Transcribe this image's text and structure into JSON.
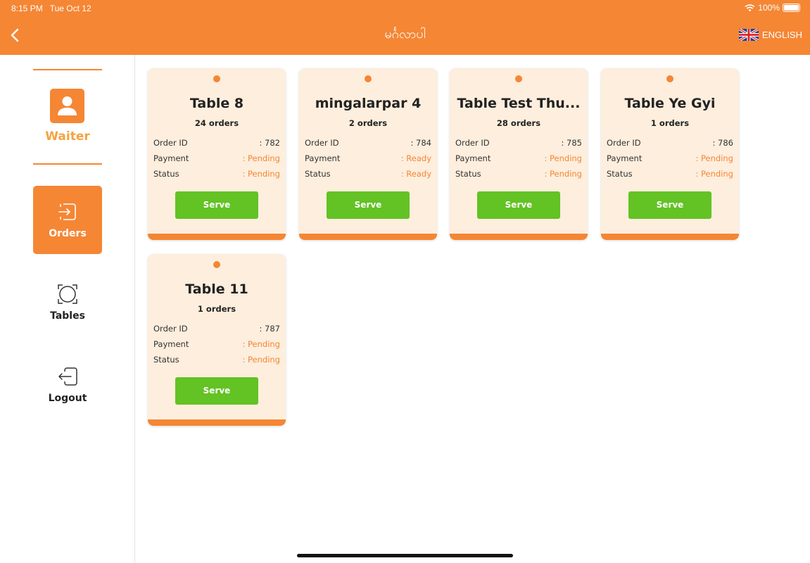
{
  "status_bar": {
    "time": "8:15 PM",
    "date": "Tue Oct 12",
    "battery": "100%"
  },
  "header": {
    "title": "မင်္ဂလာပါ",
    "language": "ENGLISH",
    "accent_color": "#f58634"
  },
  "sidebar": {
    "role_label": "Waiter",
    "items": [
      {
        "label": "Orders",
        "icon": "orders-icon",
        "active": true
      },
      {
        "label": "Tables",
        "icon": "tables-icon",
        "active": false
      },
      {
        "label": "Logout",
        "icon": "logout-icon",
        "active": false
      }
    ]
  },
  "labels": {
    "order_id": "Order ID",
    "payment": "Payment",
    "status": "Status",
    "serve": "Serve"
  },
  "cards": [
    {
      "name": "Table 8",
      "count": "24 orders",
      "order_id": ": 782",
      "payment": ": Pending",
      "status": ": Pending"
    },
    {
      "name": "mingalarpar 4",
      "count": "2 orders",
      "order_id": ": 784",
      "payment": ": Ready",
      "status": ": Ready"
    },
    {
      "name": "Table Test Thu...",
      "count": "28 orders",
      "order_id": ": 785",
      "payment": ": Pending",
      "status": ": Pending"
    },
    {
      "name": "Table Ye Gyi",
      "count": "1 orders",
      "order_id": ": 786",
      "payment": ": Pending",
      "status": ": Pending"
    },
    {
      "name": "Table 11",
      "count": "1 orders",
      "order_id": ": 787",
      "payment": ": Pending",
      "status": ": Pending"
    }
  ]
}
